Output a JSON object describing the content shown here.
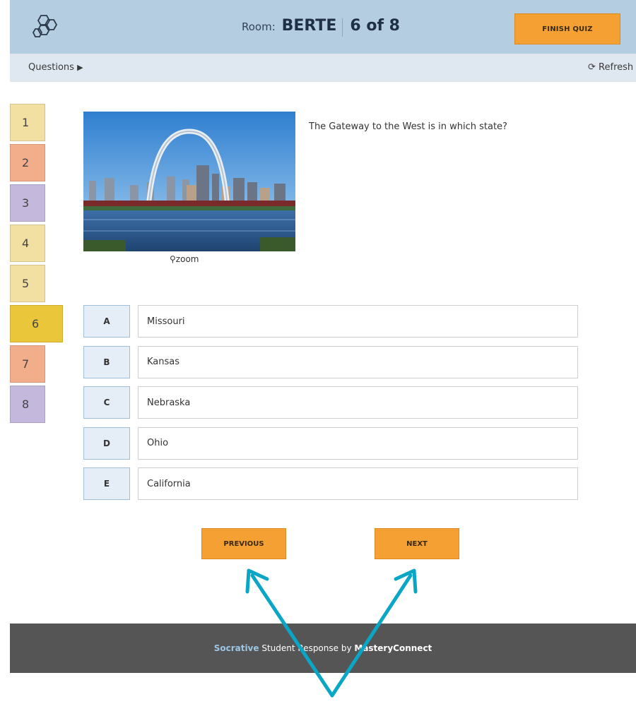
{
  "header": {
    "room_label": "Room:",
    "room_code": "BERTE",
    "progress": "6 of 8",
    "finish_label": "FINISH QUIZ"
  },
  "subbar": {
    "questions_label": "Questions",
    "refresh_label": "Refresh"
  },
  "question_nav": [
    {
      "number": "1",
      "color": "#f2dfa2"
    },
    {
      "number": "2",
      "color": "#f2ad8a"
    },
    {
      "number": "3",
      "color": "#c4b8dc"
    },
    {
      "number": "4",
      "color": "#f2dfa2"
    },
    {
      "number": "5",
      "color": "#f2dfa2"
    },
    {
      "number": "6",
      "color": "#e9c63a"
    },
    {
      "number": "7",
      "color": "#f2ad8a"
    },
    {
      "number": "8",
      "color": "#c4b8dc"
    }
  ],
  "question": {
    "text": "The Gateway to the West is in which state?",
    "zoom_label": "zoom"
  },
  "answers": [
    {
      "letter": "A",
      "text": "Missouri"
    },
    {
      "letter": "B",
      "text": "Kansas"
    },
    {
      "letter": "C",
      "text": "Nebraska"
    },
    {
      "letter": "D",
      "text": "Ohio"
    },
    {
      "letter": "E",
      "text": "California"
    }
  ],
  "buttons": {
    "previous_label": "PREVIOUS",
    "next_label": "NEXT"
  },
  "footer": {
    "brand": "Socrative",
    "middle": " Student Response by ",
    "company": "MasteryConnect"
  },
  "colors": {
    "header_bg": "#b5cde0",
    "accent_orange": "#f4a032",
    "annotation_arrow": "#0aa6c6",
    "footer_bg": "#555555"
  }
}
